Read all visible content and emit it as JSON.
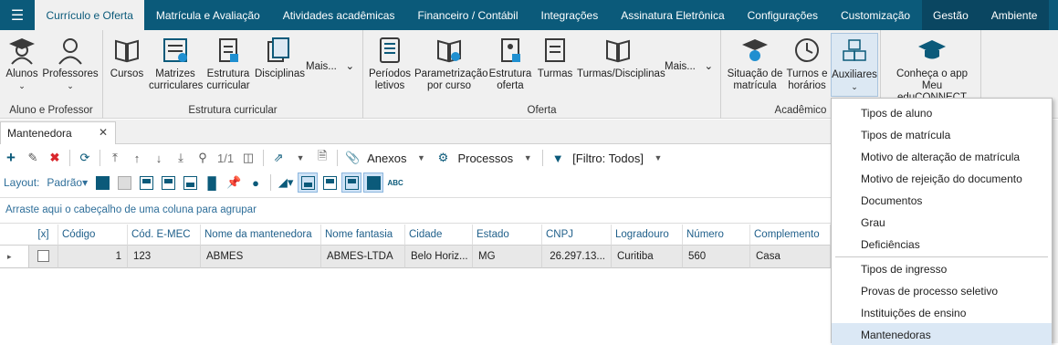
{
  "topbar": {
    "tabs": [
      {
        "label": "Currículo e Oferta",
        "state": "active"
      },
      {
        "label": "Matrícula e Avaliação"
      },
      {
        "label": "Atividades acadêmicas"
      },
      {
        "label": "Financeiro / Contábil"
      },
      {
        "label": "Integrações"
      },
      {
        "label": "Assinatura Eletrônica"
      },
      {
        "label": "Configurações"
      },
      {
        "label": "Customização"
      },
      {
        "label": "Gestão",
        "state": "dark"
      },
      {
        "label": "Ambiente"
      }
    ]
  },
  "ribbon": {
    "groups": {
      "aluno": {
        "label": "Aluno e Professor",
        "buttons": [
          {
            "label": "Alunos",
            "icon": "student-icon"
          },
          {
            "label": "Professores",
            "icon": "teacher-icon"
          }
        ]
      },
      "estrutura": {
        "label": "Estrutura curricular",
        "buttons": [
          {
            "label": "Cursos",
            "icon": "book-icon"
          },
          {
            "label": "Matrizes curriculares",
            "icon": "matrix-icon"
          },
          {
            "label": "Estrutura curricular",
            "icon": "structure-icon"
          },
          {
            "label": "Disciplinas",
            "icon": "subjects-icon"
          }
        ],
        "more": "Mais..."
      },
      "oferta": {
        "label": "Oferta",
        "buttons": [
          {
            "label": "Períodos letivos",
            "icon": "calendar-icon"
          },
          {
            "label": "Parametrização por curso",
            "icon": "settings-book-icon"
          },
          {
            "label": "Estrutura oferta",
            "icon": "structure-offer-icon"
          },
          {
            "label": "Turmas",
            "icon": "class-icon"
          },
          {
            "label": "Turmas/Disciplinas",
            "icon": "class-subjects-icon"
          }
        ],
        "more": "Mais..."
      },
      "academico": {
        "label": "Acadêmico",
        "buttons": [
          {
            "label": "Situação de matrícula",
            "icon": "cap-icon"
          },
          {
            "label": "Turnos e horários",
            "icon": "clock-icon"
          },
          {
            "label": "Auxiliares",
            "icon": "cubes-icon"
          }
        ]
      },
      "app": {
        "buttons": [
          {
            "label": "Conheça o app Meu eduCONNECT",
            "icon": "mortarboard-icon"
          }
        ]
      }
    }
  },
  "doc_tab": {
    "label": "Mantenedora"
  },
  "toolbar": {
    "pager": "1/1",
    "anexos": "Anexos",
    "processos": "Processos",
    "filtro": "[Filtro: Todos]",
    "layout_label": "Layout:",
    "layout_value": "Padrão"
  },
  "group_hint": "Arraste aqui o cabeçalho de uma coluna para agrupar",
  "grid": {
    "columns": [
      "[x]",
      "Código",
      "Cód. E-MEC",
      "Nome da mantenedora",
      "Nome fantasia",
      "Cidade",
      "Estado",
      "CNPJ",
      "Logradouro",
      "Número",
      "Complemento"
    ],
    "rows": [
      {
        "codigo": "1",
        "emec": "123",
        "nome": "ABMES",
        "fantasia": "ABMES-LTDA",
        "cidade": "Belo Horiz...",
        "estado": "MG",
        "cnpj": "26.297.13...",
        "logradouro": "Curitiba",
        "numero": "560",
        "complemento": "Casa"
      }
    ]
  },
  "dropdown": {
    "items": [
      "Tipos de aluno",
      "Tipos de matrícula",
      "Motivo de alteração de matrícula",
      "Motivo de rejeição do documento",
      "Documentos",
      "Grau",
      "Deficiências",
      "Tipos de ingresso",
      "Provas de processo seletivo",
      "Instituições de ensino",
      "Mantenedoras"
    ],
    "active": "Mantenedoras"
  },
  "colors": {
    "brand": "#0b5a7a",
    "active_tab_bg": "#f0f0f0",
    "highlight": "#dbe8f5"
  }
}
